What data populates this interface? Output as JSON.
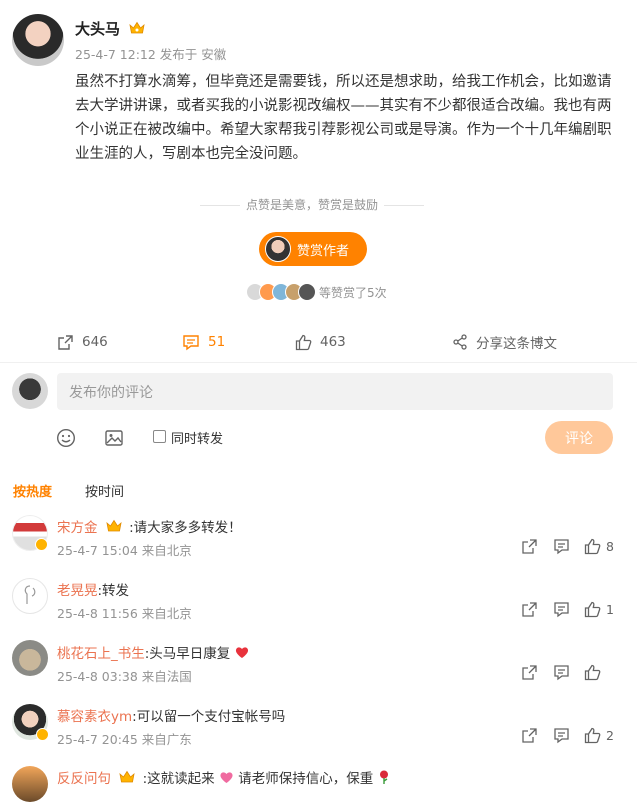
{
  "post": {
    "author": "大头马",
    "meta": "25-4-7 12:12 发布于 安徽",
    "body": "虽然不打算水滴筹，但毕竟还是需要钱，所以还是想求助，给我工作机会，比如邀请去大学讲讲课，或者买我的小说影视改编权——其实有不少都很适合改编。我也有两个小说正在被改编中。希望大家帮我引荐影视公司或是导演。作为一个十几年编剧职业生涯的人，写剧本也完全没问题。",
    "reward_slogan": "点赞是美意，赞赏是鼓励",
    "reward_button": "赞赏作者",
    "rewarders_text": "等赞赏了5次"
  },
  "actions": {
    "repost": "646",
    "comments": "51",
    "likes": "463",
    "share": "分享这条博文"
  },
  "composer": {
    "placeholder": "发布你的评论",
    "repost_label": "同时转发",
    "submit": "评论"
  },
  "sort": {
    "hot": "按热度",
    "time": "按时间"
  },
  "comments": [
    {
      "user": "宋方金",
      "text": ":请大家多多转发！",
      "meta": "25-4-7 15:04 来自北京",
      "likes": "8"
    },
    {
      "user": "老晃晃",
      "text": ":转发",
      "meta": "25-4-8 11:56 来自北京",
      "likes": "1"
    },
    {
      "user": "桃花石上_书生",
      "text": ":头马早日康复",
      "meta": "25-4-8 03:38 来自法国",
      "likes": ""
    },
    {
      "user": "慕容素衣ym",
      "text": ":可以留一个支付宝帐号吗",
      "meta": "25-4-7 20:45 来自广东",
      "likes": "2"
    },
    {
      "user": "反反问句",
      "text": ":这就读起来",
      "text2": "请老师保持信心，保重",
      "meta": "",
      "likes": ""
    }
  ],
  "colors": {
    "accent": "#ff8200",
    "username": "#eb7350",
    "muted": "#939393"
  }
}
